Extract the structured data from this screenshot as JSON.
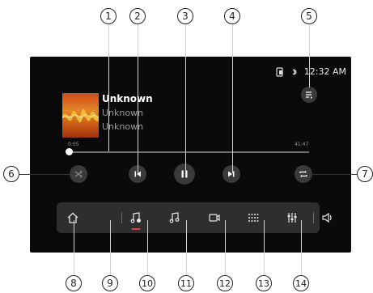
{
  "status": {
    "time": "12:32 AM"
  },
  "track": {
    "title": "Unknown",
    "artist": "Unknown",
    "album": "Unknown"
  },
  "progress": {
    "elapsed": "0:05",
    "total": "41:47",
    "fraction": 0.002
  },
  "controls": {
    "shuffle": "shuffle-icon",
    "previous": "previous-icon",
    "pause": "pause-icon",
    "next": "next-icon",
    "repeat": "repeat-icon",
    "queue": "queue-icon"
  },
  "dock": {
    "items": [
      "home-icon",
      "music-playing-icon",
      "music-icon",
      "video-icon",
      "apps-icon",
      "equalizer-icon",
      "volume-icon"
    ],
    "active_color": "#e04040"
  },
  "callouts": [
    "1",
    "2",
    "3",
    "4",
    "5",
    "6",
    "7",
    "8",
    "9",
    "10",
    "11",
    "12",
    "13",
    "14"
  ]
}
